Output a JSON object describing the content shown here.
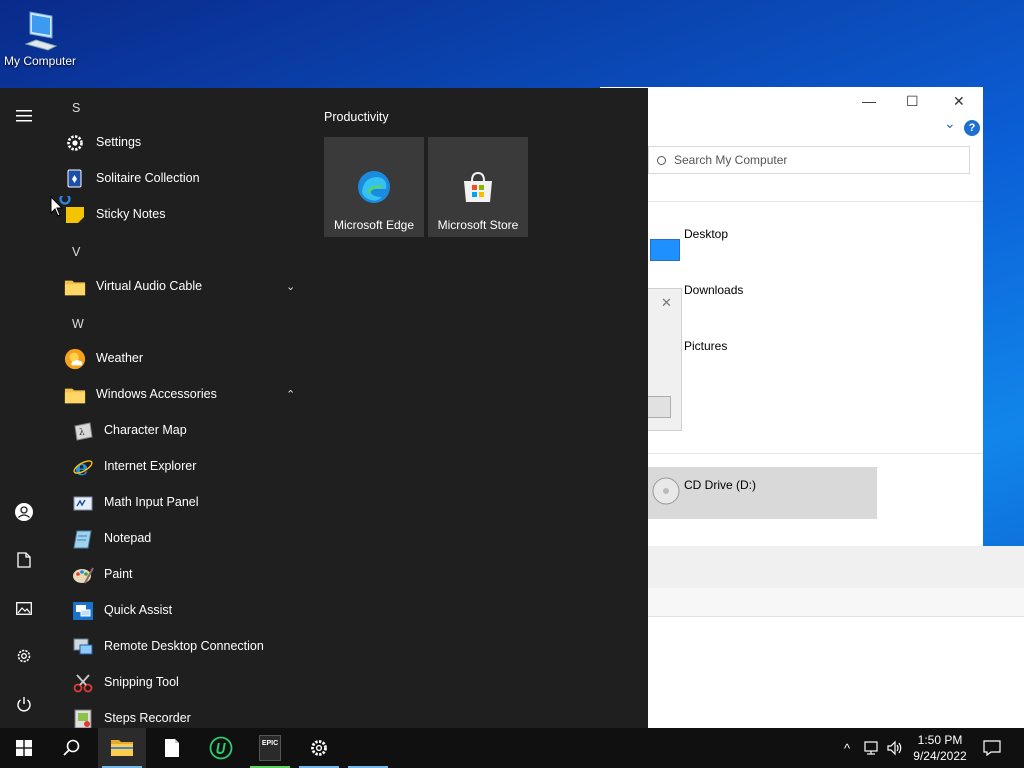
{
  "desktop": {
    "icons": [
      {
        "label": "My Computer",
        "icon": "computer-icon"
      }
    ]
  },
  "explorer": {
    "search_placeholder": "Search My Computer",
    "items": [
      {
        "label": "Desktop",
        "icon": "desktop-folder-icon"
      },
      {
        "label": "Downloads",
        "icon": "downloads-folder-icon"
      },
      {
        "label": "Pictures",
        "icon": "pictures-folder-icon"
      }
    ],
    "drive": {
      "label": "CD Drive (D:)",
      "icon": "cd-drive-icon"
    },
    "controls": {
      "minimize": "—",
      "maximize": "☐",
      "close": "✕",
      "help": "?",
      "expand": "⌄"
    }
  },
  "start_menu": {
    "rail": [
      {
        "name": "menu",
        "icon": "hamburger-icon"
      },
      {
        "name": "account",
        "icon": "user-icon"
      },
      {
        "name": "documents",
        "icon": "document-icon"
      },
      {
        "name": "pictures",
        "icon": "picture-icon"
      },
      {
        "name": "settings",
        "icon": "gear-icon"
      },
      {
        "name": "power",
        "icon": "power-icon"
      }
    ],
    "letters": {
      "s": "S",
      "v": "V",
      "w": "W"
    },
    "apps": [
      {
        "label": "Settings",
        "icon": "gear-icon"
      },
      {
        "label": "Solitaire Collection",
        "icon": "cards-icon"
      },
      {
        "label": "Sticky Notes",
        "icon": "sticky-note-icon"
      },
      {
        "label": "Virtual Audio Cable",
        "icon": "folder-icon",
        "expand": "⌄"
      },
      {
        "label": "Weather",
        "icon": "weather-icon"
      },
      {
        "label": "Windows Accessories",
        "icon": "folder-icon",
        "expand": "⌃"
      },
      {
        "label": "Character Map",
        "icon": "character-map-icon"
      },
      {
        "label": "Internet Explorer",
        "icon": "internet-explorer-icon"
      },
      {
        "label": "Math Input Panel",
        "icon": "math-input-icon"
      },
      {
        "label": "Notepad",
        "icon": "notepad-icon"
      },
      {
        "label": "Paint",
        "icon": "paint-icon"
      },
      {
        "label": "Quick Assist",
        "icon": "quick-assist-icon"
      },
      {
        "label": "Remote Desktop Connection",
        "icon": "remote-desktop-icon"
      },
      {
        "label": "Snipping Tool",
        "icon": "snipping-tool-icon"
      },
      {
        "label": "Steps Recorder",
        "icon": "steps-recorder-icon"
      }
    ],
    "tiles_group": "Productivity",
    "tiles": [
      {
        "label": "Microsoft Edge",
        "icon": "edge-icon"
      },
      {
        "label": "Microsoft Store",
        "icon": "store-icon"
      }
    ]
  },
  "taskbar": {
    "buttons": [
      {
        "name": "start",
        "icon": "windows-logo-icon"
      },
      {
        "name": "search",
        "icon": "search-icon"
      },
      {
        "name": "file-explorer",
        "icon": "folder-icon"
      },
      {
        "name": "notepad",
        "icon": "notepad-icon"
      },
      {
        "name": "unigine",
        "icon": "unigine-icon"
      },
      {
        "name": "epic-games",
        "icon": "epic-games-icon",
        "text": "EPIC"
      },
      {
        "name": "settings",
        "icon": "gear-icon"
      }
    ],
    "tray": {
      "chevron": "^",
      "time": "1:50 PM",
      "date": "9/24/2022"
    }
  },
  "colors": {
    "accent": "#0078d7",
    "start_bg": "#1f1f1f",
    "taskbar_bg": "#101010",
    "tile_bg": "#3a3a3a"
  }
}
